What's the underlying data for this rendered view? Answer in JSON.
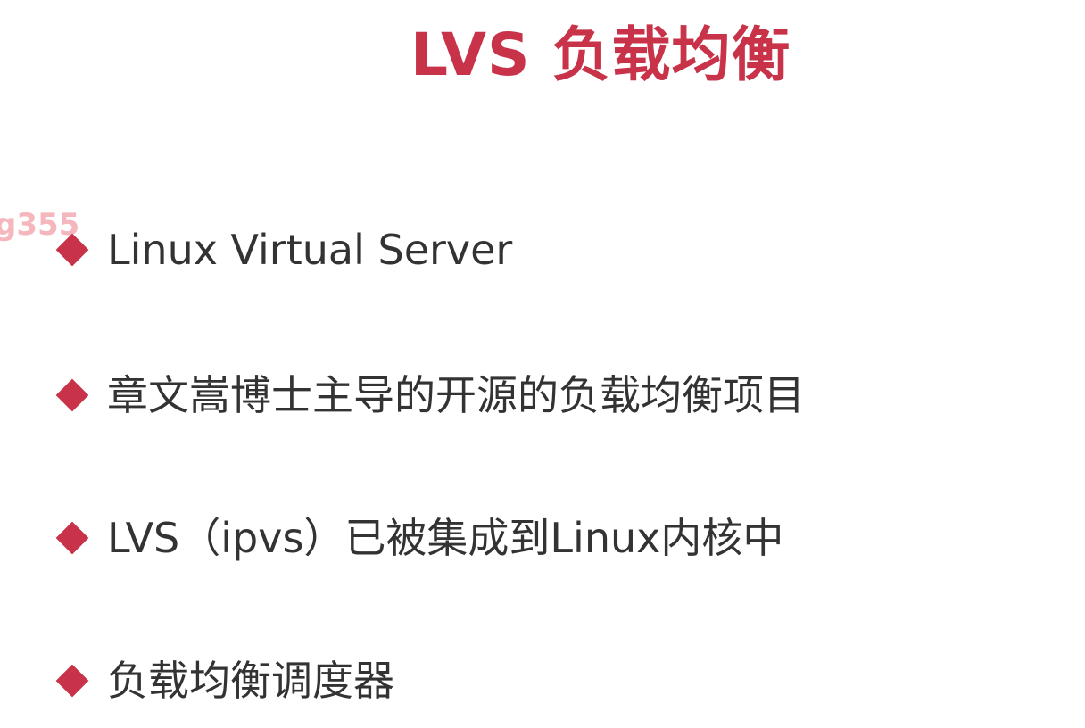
{
  "slide": {
    "title": "LVS 负载均衡",
    "watermark": "g355",
    "bullets": [
      "Linux Virtual Server",
      "章文嵩博士主导的开源的负载均衡项目",
      "LVS（ipvs）已被集成到Linux内核中",
      "负载均衡调度器"
    ]
  },
  "colors": {
    "accent": "#c8334a",
    "text": "#333333",
    "watermark": "#f2a0a8",
    "background": "#ffffff"
  },
  "icons": {
    "bullet": "diamond-bullet-icon"
  }
}
